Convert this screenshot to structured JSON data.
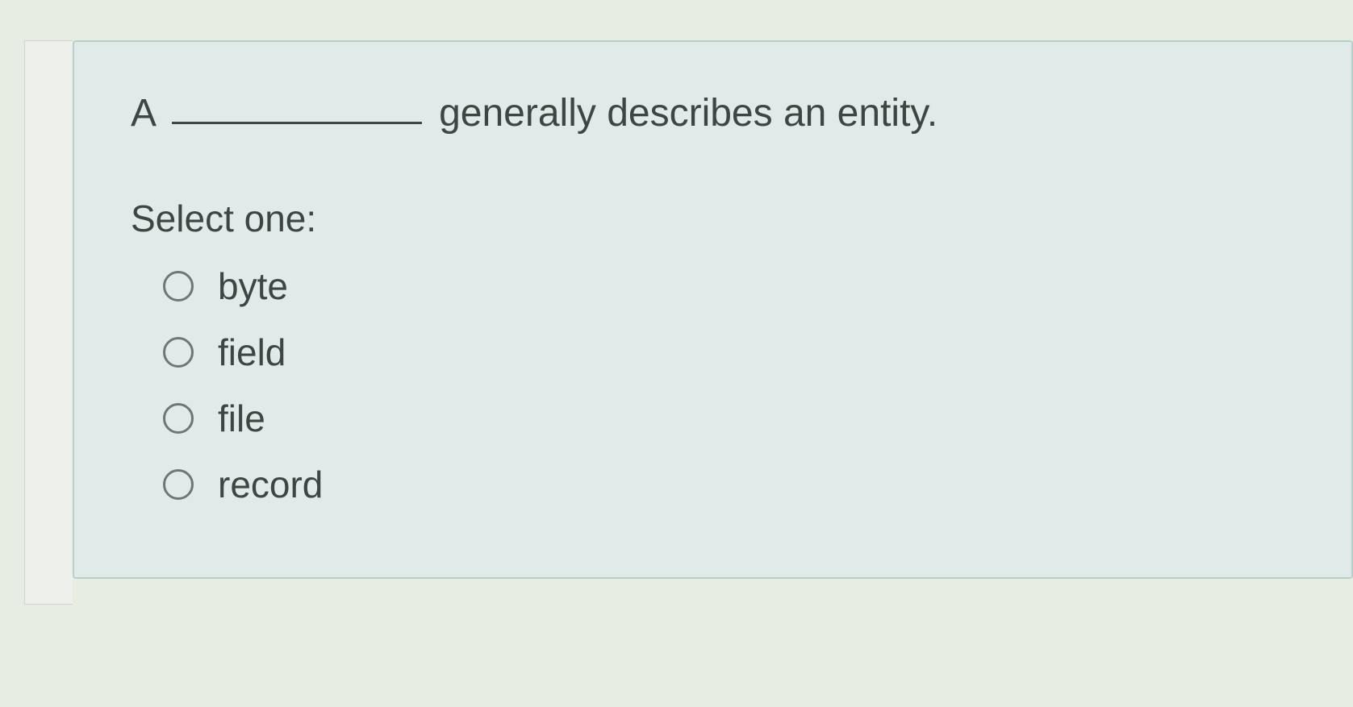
{
  "question": {
    "prefix": "A",
    "suffix": "generally describes an entity."
  },
  "prompt": "Select one:",
  "options": [
    {
      "label": "byte"
    },
    {
      "label": "field"
    },
    {
      "label": "file"
    },
    {
      "label": "record"
    }
  ]
}
